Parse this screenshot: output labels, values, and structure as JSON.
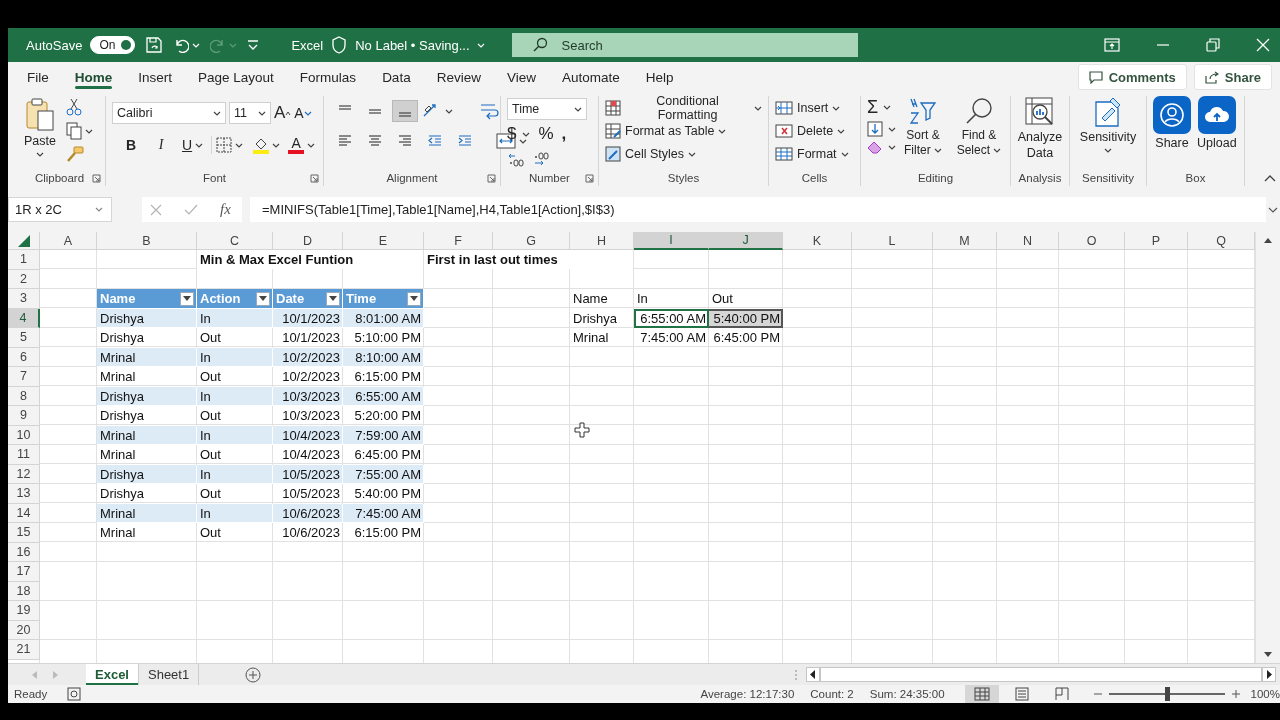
{
  "title_bar": {
    "autosave_label": "AutoSave",
    "autosave": {
      "label": "On",
      "on": true
    },
    "app": "Excel",
    "sensitivity_label": "No Label • Saving...",
    "search": {
      "placeholder": "Search"
    }
  },
  "ribbon_tabs": [
    {
      "label": "File",
      "selected": false
    },
    {
      "label": "Home",
      "selected": true
    },
    {
      "label": "Insert",
      "selected": false
    },
    {
      "label": "Page Layout",
      "selected": false
    },
    {
      "label": "Formulas",
      "selected": false
    },
    {
      "label": "Data",
      "selected": false
    },
    {
      "label": "Review",
      "selected": false
    },
    {
      "label": "View",
      "selected": false
    },
    {
      "label": "Automate",
      "selected": false
    },
    {
      "label": "Help",
      "selected": false
    }
  ],
  "ribbon_actions": {
    "comments": "Comments",
    "share": "Share"
  },
  "ribbon": {
    "clipboard": {
      "paste": "Paste",
      "label": "Clipboard"
    },
    "font": {
      "name": "Calibri",
      "size": "11",
      "grow": "A",
      "shrink": "A",
      "bold": "B",
      "italic": "I",
      "underline": "U",
      "color_letter": "A",
      "label": "Font"
    },
    "alignment": {
      "label": "Alignment"
    },
    "number": {
      "format": "Time",
      "currency": "$",
      "percent": "%",
      "comma": ",",
      "label": "Number"
    },
    "styles": {
      "items": [
        "Conditional Formatting",
        "Format as Table",
        "Cell Styles"
      ],
      "label": "Styles"
    },
    "cells": {
      "items": [
        "Insert",
        "Delete",
        "Format"
      ],
      "label": "Cells"
    },
    "editing": {
      "sum": "Σ",
      "sort": "Sort & Filter",
      "find": "Find & Select",
      "label": "Editing"
    },
    "analysis": {
      "button": "Analyze Data",
      "label": "Analysis"
    },
    "sensitivity": {
      "button": "Sensitivity",
      "label": "Sensitivity"
    },
    "box": {
      "share": "Share",
      "upload": "Upload",
      "label": "Box"
    }
  },
  "formula_bar": {
    "name_box": "1R x 2C",
    "function_symbol": "fx",
    "formula": "=MINIFS(Table1[Time],Table1[Name],H4,Table1[Action],$I$3)"
  },
  "sheet": {
    "columns": [
      {
        "label": "A",
        "selected": false
      },
      {
        "label": "B",
        "selected": false
      },
      {
        "label": "C",
        "selected": false
      },
      {
        "label": "D",
        "selected": false
      },
      {
        "label": "E",
        "selected": false
      },
      {
        "label": "F",
        "selected": false
      },
      {
        "label": "G",
        "selected": false
      },
      {
        "label": "H",
        "selected": false
      },
      {
        "label": "I",
        "selected": true
      },
      {
        "label": "J",
        "selected": true
      },
      {
        "label": "K",
        "selected": false
      },
      {
        "label": "L",
        "selected": false
      },
      {
        "label": "M",
        "selected": false
      },
      {
        "label": "N",
        "selected": false
      },
      {
        "label": "O",
        "selected": false
      },
      {
        "label": "P",
        "selected": false
      },
      {
        "label": "Q",
        "selected": false
      }
    ],
    "rows": [
      {
        "label": "1",
        "selected": false,
        "cells": [
          {
            "kind": "empty"
          },
          {
            "kind": "empty"
          },
          {
            "kind": "title",
            "value": "Min & Max Excel Funtion"
          },
          {
            "kind": "empty"
          },
          {
            "kind": "empty"
          },
          {
            "kind": "title",
            "value": "First in last out times"
          }
        ]
      },
      {
        "label": "2",
        "selected": false
      },
      {
        "label": "3",
        "selected": false,
        "cells": [
          {
            "kind": "empty"
          },
          {
            "kind": "header",
            "value": "Name"
          },
          {
            "kind": "header",
            "value": "Action"
          },
          {
            "kind": "header",
            "value": "Date"
          },
          {
            "kind": "header",
            "value": "Time"
          },
          {
            "kind": "empty"
          },
          {
            "kind": "empty"
          },
          {
            "kind": "plain",
            "value": "Name"
          },
          {
            "kind": "plain",
            "value": "In"
          },
          {
            "kind": "plain",
            "value": "Out"
          }
        ]
      },
      {
        "label": "4",
        "selected": true,
        "cells": [
          {
            "kind": "empty"
          },
          {
            "kind": "band",
            "value": "Drishya"
          },
          {
            "kind": "band",
            "value": "In"
          },
          {
            "kind": "band",
            "value": "10/1/2023",
            "numeric": true
          },
          {
            "kind": "band",
            "value": "8:01:00 AM",
            "numeric": true
          },
          {
            "kind": "empty"
          },
          {
            "kind": "empty"
          },
          {
            "kind": "plain",
            "value": "Drishya"
          },
          {
            "kind": "active",
            "value": "6:55:00 AM",
            "numeric": true
          },
          {
            "kind": "range",
            "value": "5:40:00 PM",
            "numeric": true
          }
        ]
      },
      {
        "label": "5",
        "selected": false,
        "cells": [
          {
            "kind": "empty"
          },
          {
            "kind": "plain",
            "value": "Drishya"
          },
          {
            "kind": "plain",
            "value": "Out"
          },
          {
            "kind": "plain",
            "value": "10/1/2023",
            "numeric": true
          },
          {
            "kind": "plain",
            "value": "5:10:00 PM",
            "numeric": true
          },
          {
            "kind": "empty"
          },
          {
            "kind": "empty"
          },
          {
            "kind": "plain",
            "value": "Mrinal"
          },
          {
            "kind": "plain",
            "value": "7:45:00 AM",
            "numeric": true
          },
          {
            "kind": "plain",
            "value": "6:45:00 PM",
            "numeric": true
          }
        ]
      },
      {
        "label": "6",
        "selected": false,
        "cells": [
          {
            "kind": "empty"
          },
          {
            "kind": "band",
            "value": "Mrinal"
          },
          {
            "kind": "band",
            "value": "In"
          },
          {
            "kind": "band",
            "value": "10/2/2023",
            "numeric": true
          },
          {
            "kind": "band",
            "value": "8:10:00 AM",
            "numeric": true
          }
        ]
      },
      {
        "label": "7",
        "selected": false,
        "cells": [
          {
            "kind": "empty"
          },
          {
            "kind": "plain",
            "value": "Mrinal"
          },
          {
            "kind": "plain",
            "value": "Out"
          },
          {
            "kind": "plain",
            "value": "10/2/2023",
            "numeric": true
          },
          {
            "kind": "plain",
            "value": "6:15:00 PM",
            "numeric": true
          }
        ]
      },
      {
        "label": "8",
        "selected": false,
        "cells": [
          {
            "kind": "empty"
          },
          {
            "kind": "band",
            "value": "Drishya"
          },
          {
            "kind": "band",
            "value": "In"
          },
          {
            "kind": "band",
            "value": "10/3/2023",
            "numeric": true
          },
          {
            "kind": "band",
            "value": "6:55:00 AM",
            "numeric": true
          }
        ]
      },
      {
        "label": "9",
        "selected": false,
        "cells": [
          {
            "kind": "empty"
          },
          {
            "kind": "plain",
            "value": "Drishya"
          },
          {
            "kind": "plain",
            "value": "Out"
          },
          {
            "kind": "plain",
            "value": "10/3/2023",
            "numeric": true
          },
          {
            "kind": "plain",
            "value": "5:20:00 PM",
            "numeric": true
          }
        ]
      },
      {
        "label": "10",
        "selected": false,
        "cells": [
          {
            "kind": "empty"
          },
          {
            "kind": "band",
            "value": "Mrinal"
          },
          {
            "kind": "band",
            "value": "In"
          },
          {
            "kind": "band",
            "value": "10/4/2023",
            "numeric": true
          },
          {
            "kind": "band",
            "value": "7:59:00 AM",
            "numeric": true
          }
        ]
      },
      {
        "label": "11",
        "selected": false,
        "cells": [
          {
            "kind": "empty"
          },
          {
            "kind": "plain",
            "value": "Mrinal"
          },
          {
            "kind": "plain",
            "value": "Out"
          },
          {
            "kind": "plain",
            "value": "10/4/2023",
            "numeric": true
          },
          {
            "kind": "plain",
            "value": "6:45:00 PM",
            "numeric": true
          }
        ]
      },
      {
        "label": "12",
        "selected": false,
        "cells": [
          {
            "kind": "empty"
          },
          {
            "kind": "band",
            "value": "Drishya"
          },
          {
            "kind": "band",
            "value": "In"
          },
          {
            "kind": "band",
            "value": "10/5/2023",
            "numeric": true
          },
          {
            "kind": "band",
            "value": "7:55:00 AM",
            "numeric": true
          }
        ]
      },
      {
        "label": "13",
        "selected": false,
        "cells": [
          {
            "kind": "empty"
          },
          {
            "kind": "plain",
            "value": "Drishya"
          },
          {
            "kind": "plain",
            "value": "Out"
          },
          {
            "kind": "plain",
            "value": "10/5/2023",
            "numeric": true
          },
          {
            "kind": "plain",
            "value": "5:40:00 PM",
            "numeric": true
          }
        ]
      },
      {
        "label": "14",
        "selected": false,
        "cells": [
          {
            "kind": "empty"
          },
          {
            "kind": "band",
            "value": "Mrinal"
          },
          {
            "kind": "band",
            "value": "In"
          },
          {
            "kind": "band",
            "value": "10/6/2023",
            "numeric": true
          },
          {
            "kind": "band",
            "value": "7:45:00 AM",
            "numeric": true
          }
        ]
      },
      {
        "label": "15",
        "selected": false,
        "cells": [
          {
            "kind": "empty"
          },
          {
            "kind": "plain",
            "value": "Mrinal"
          },
          {
            "kind": "plain",
            "value": "Out"
          },
          {
            "kind": "plain",
            "value": "10/6/2023",
            "numeric": true
          },
          {
            "kind": "plain",
            "value": "6:15:00 PM",
            "numeric": true
          }
        ]
      },
      {
        "label": "16",
        "selected": false
      },
      {
        "label": "17",
        "selected": false
      },
      {
        "label": "18",
        "selected": false
      },
      {
        "label": "19",
        "selected": false
      },
      {
        "label": "20",
        "selected": false
      },
      {
        "label": "21",
        "selected": false
      }
    ]
  },
  "sheet_tabs": [
    {
      "label": "Excel",
      "selected": true
    },
    {
      "label": "Sheet1",
      "selected": false
    }
  ],
  "status_bar": {
    "mode": "Ready",
    "average": "Average: 12:17:30",
    "count": "Count: 2",
    "sum": "Sum: 24:35:00",
    "views": [
      {
        "kind": "normal",
        "selected": true
      },
      {
        "kind": "page-layout",
        "selected": false
      },
      {
        "kind": "page-break",
        "selected": false
      }
    ],
    "zoom": {
      "level": 0.5,
      "reading": "100%"
    }
  }
}
